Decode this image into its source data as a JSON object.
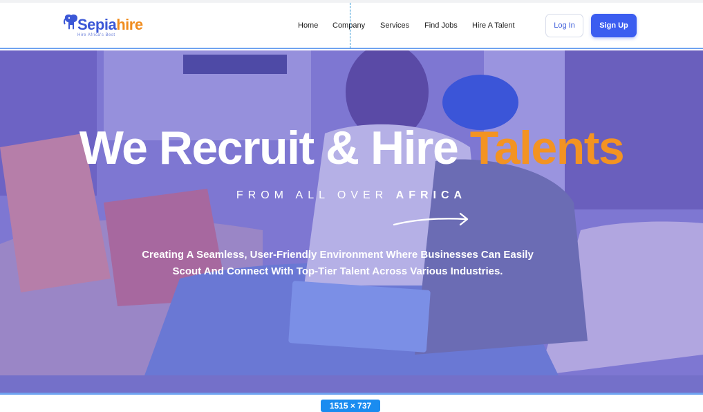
{
  "brand": {
    "name_part1": "Sepia",
    "name_part2": "hire",
    "tagline": "Hire Africa's Best",
    "primary_color": "#3b5df0",
    "accent_color": "#f39322"
  },
  "nav": {
    "links": [
      {
        "label": "Home"
      },
      {
        "label": "Company"
      },
      {
        "label": "Services"
      },
      {
        "label": "Find Jobs"
      },
      {
        "label": "Hire A Talent"
      }
    ],
    "login_label": "Log In",
    "signup_label": "Sign Up"
  },
  "hero": {
    "title_main": "We Recruit & Hire ",
    "title_accent": "Talents",
    "subtitle_main": "FROM ALL OVER ",
    "subtitle_bold": "AFRICA",
    "description": "Creating A Seamless, User-Friendly Environment Where Businesses Can Easily Scout And Connect With Top-Tier Talent Across Various Industries."
  },
  "overlay": {
    "size_badge": "1515 × 737"
  }
}
